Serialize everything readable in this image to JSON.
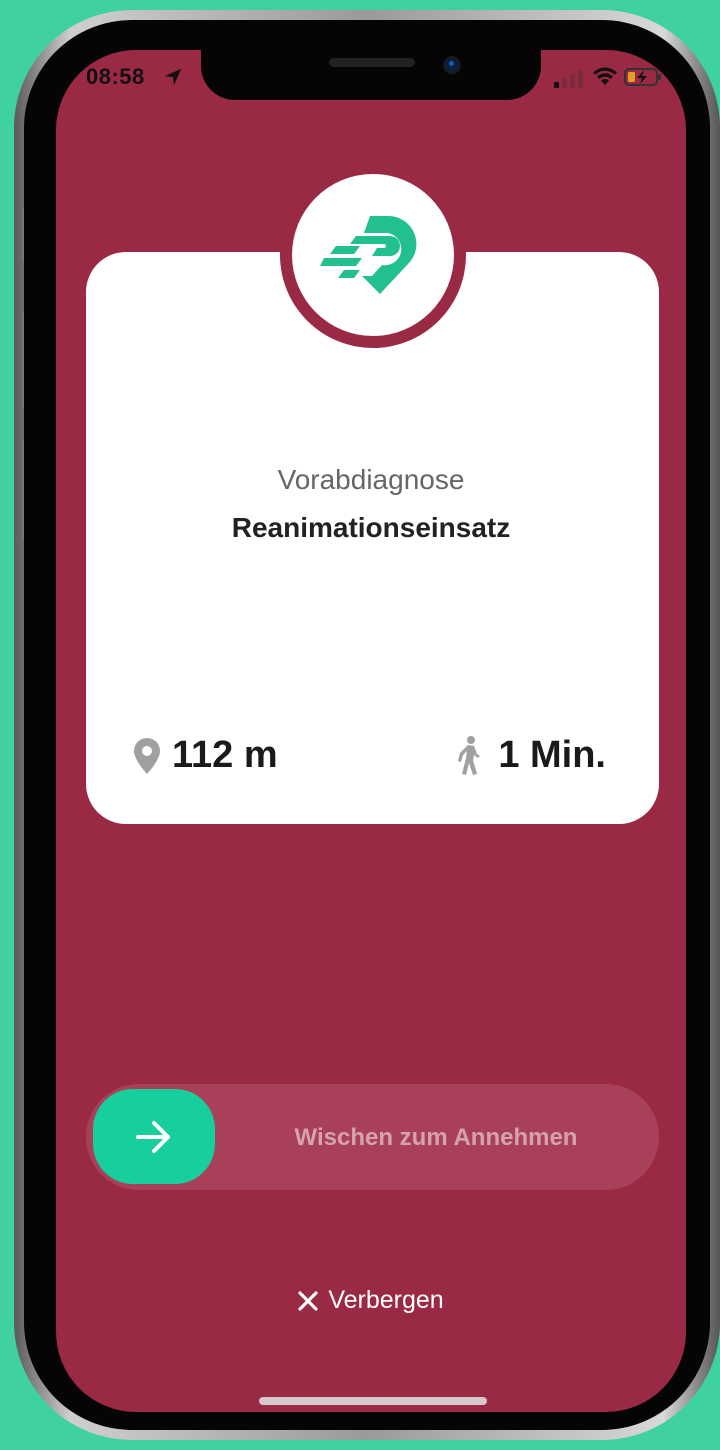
{
  "status_bar": {
    "time": "08:58",
    "location_icon": "location-arrow-icon",
    "signal_icon": "cellular-signal-icon",
    "wifi_icon": "wifi-icon",
    "battery_icon": "battery-charging-icon"
  },
  "app_logo": "dispatch-location-logo",
  "diagnosis": {
    "label": "Vorabdiagnose",
    "value": "Reanimationseinsatz"
  },
  "metrics": {
    "distance": "112 m",
    "distance_icon": "location-pin-icon",
    "walk_time": "1 Min.",
    "walk_icon": "walking-person-icon"
  },
  "slider": {
    "label": "Wischen zum Annehmen",
    "icon": "arrow-right-icon"
  },
  "hide": {
    "label": "Verbergen",
    "icon": "close-icon"
  },
  "colors": {
    "background": "#9a2943",
    "accent": "#17cf9c",
    "card": "#ffffff",
    "outer_background": "#3fd1a0"
  }
}
